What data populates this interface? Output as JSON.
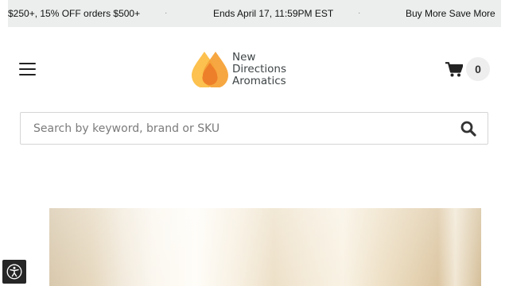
{
  "promo_bar": {
    "items": [
      "$250+, 15% OFF orders $500+",
      "Ends April 17, 11:59PM EST",
      "Buy More Save More"
    ],
    "separator": "·"
  },
  "header": {
    "logo": {
      "line1": "New",
      "line2": "Directions",
      "line3": "Aromatics"
    },
    "cart_count": "0"
  },
  "search": {
    "placeholder": "Search by keyword, brand or SKU",
    "value": ""
  },
  "icons": {
    "menu": "hamburger-icon",
    "cart": "shopping-cart-icon",
    "search": "magnifier-icon",
    "accessibility": "accessibility-icon"
  },
  "colors": {
    "promo_bg": "#eceeee",
    "logo_drop_light": "#fcc14e",
    "logo_drop_dark": "#f08a2c",
    "logo_text": "#3e4446",
    "accessibility_bg": "#262626"
  }
}
